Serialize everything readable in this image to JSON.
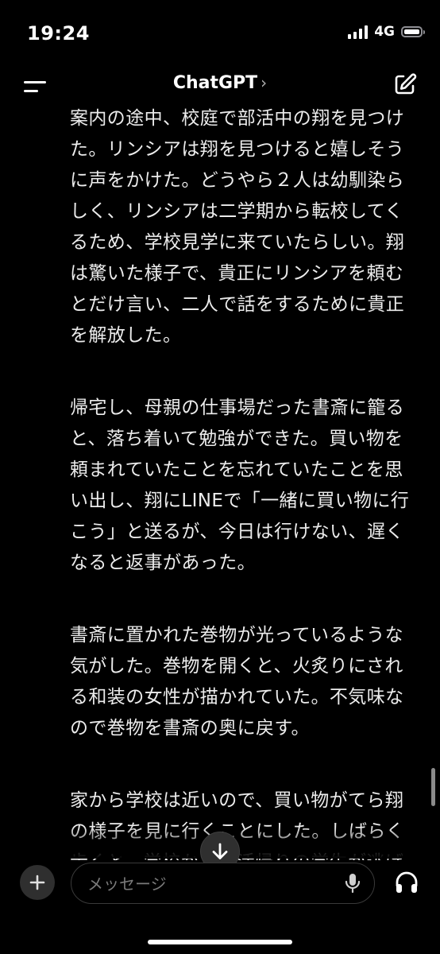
{
  "status_bar": {
    "time": "19:24",
    "network": "4G"
  },
  "header": {
    "title": "ChatGPT",
    "title_chevron": "›",
    "icons": {
      "menu": "menu-icon",
      "edit": "edit-icon"
    }
  },
  "message": {
    "paragraphs": [
      "案内の途中、校庭で部活中の翔を見つけた。リンシアは翔を見つけると嬉しそうに声をかけた。どうやら２人は幼馴染らしく、リンシアは二学期から転校してくるため、学校見学に来ていたらしい。翔は驚いた様子で、貴正にリンシアを頼むとだけ言い、二人で話をするために貴正を解放した。",
      "帰宅し、母親の仕事場だった書斎に籠ると、落ち着いて勉強ができた。買い物を頼まれていたことを忘れていたことを思い出し、翔にLINEで「一緒に買い物に行こう」と送るが、今日は行けない、遅くなると返事があった。",
      "書斎に置かれた巻物が光っているような気がした。巻物を開くと、火炙りにされる和装の女性が描かれていた。不気味なので巻物を書斎の奥に戻す。",
      "家から学校は近いので、買い物がてら翔の様子を見に行くことにした。しばらく歩くと、学校から部活帰りの学生が逃げ出してきた。化け物が出たという。"
    ]
  },
  "composer": {
    "placeholder": "メッセージ",
    "icons": {
      "plus": "plus-icon",
      "mic": "mic-icon",
      "headphones": "headphones-icon",
      "scroll_down": "arrow-down-icon"
    }
  },
  "colors": {
    "background": "#000000",
    "text": "#ececec",
    "button_bg": "#2f2f2f",
    "border": "#3a3a3a",
    "placeholder": "#7a7a7a"
  }
}
